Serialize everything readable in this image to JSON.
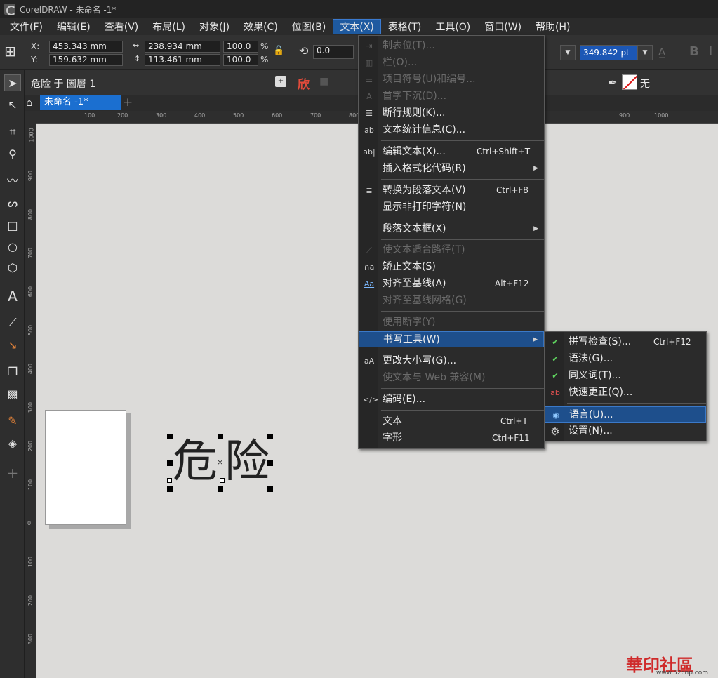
{
  "app": {
    "title": "CorelDRAW - 未命名 -1*"
  },
  "menubar": [
    "文件(F)",
    "编辑(E)",
    "查看(V)",
    "布局(L)",
    "对象(J)",
    "效果(C)",
    "位图(B)",
    "文本(X)",
    "表格(T)",
    "工具(O)",
    "窗口(W)",
    "帮助(H)"
  ],
  "props": {
    "x_label": "X:",
    "y_label": "Y:",
    "x": "453.343 mm",
    "y": "159.632 mm",
    "w": "238.934 mm",
    "h": "113.461 mm",
    "sx": "100.0",
    "sy": "100.0",
    "pct": "%",
    "rot": "0.0",
    "fontsize": "349.842 pt"
  },
  "props2": {
    "layer": "危险 于 圖層 1",
    "outline_none": "无"
  },
  "tab": {
    "name": "未命名 -1*"
  },
  "ruler_h": [
    "100",
    "200",
    "300",
    "400",
    "500",
    "600",
    "700",
    "800",
    "900",
    "1000"
  ],
  "ruler_v": [
    "1000",
    "900",
    "800",
    "700",
    "600",
    "500",
    "400",
    "300",
    "200",
    "100",
    "0",
    "100",
    "200",
    "300"
  ],
  "canvas_text": "危险",
  "text_menu": [
    {
      "label": "制表位(T)...",
      "disabled": true
    },
    {
      "label": "栏(O)...",
      "disabled": true
    },
    {
      "label": "项目符号(U)和编号...",
      "disabled": true
    },
    {
      "label": "首字下沉(D)...",
      "disabled": true
    },
    {
      "label": "断行规则(K)..."
    },
    {
      "label": "文本统计信息(C)..."
    },
    {
      "label": "编辑文本(X)...",
      "shortcut": "Ctrl+Shift+T"
    },
    {
      "label": "插入格式化代码(R)",
      "submenu": true
    },
    {
      "label": "转换为段落文本(V)",
      "shortcut": "Ctrl+F8"
    },
    {
      "label": "显示非打印字符(N)"
    },
    {
      "label": "段落文本框(X)",
      "submenu": true
    },
    {
      "label": "使文本适合路径(T)",
      "disabled": true
    },
    {
      "label": "矫正文本(S)"
    },
    {
      "label": "对齐至基线(A)",
      "shortcut": "Alt+F12"
    },
    {
      "label": "对齐至基线网格(G)",
      "disabled": true
    },
    {
      "label": "使用断字(Y)",
      "disabled": true
    },
    {
      "label": "书写工具(W)",
      "submenu": true,
      "highlighted": true
    },
    {
      "label": "更改大小写(G)..."
    },
    {
      "label": "使文本与 Web 兼容(M)",
      "disabled": true
    },
    {
      "label": "编码(E)..."
    },
    {
      "label": "文本",
      "shortcut": "Ctrl+T"
    },
    {
      "label": "字形",
      "shortcut": "Ctrl+F11"
    }
  ],
  "writing_submenu": [
    {
      "label": "拼写检查(S)...",
      "shortcut": "Ctrl+F12"
    },
    {
      "label": "语法(G)..."
    },
    {
      "label": "同义词(T)..."
    },
    {
      "label": "快速更正(Q)..."
    },
    {
      "label": "语言(U)...",
      "highlighted": true
    },
    {
      "label": "设置(N)..."
    }
  ],
  "watermark": {
    "text": "華印社區",
    "url": "www.52cnp.com"
  }
}
